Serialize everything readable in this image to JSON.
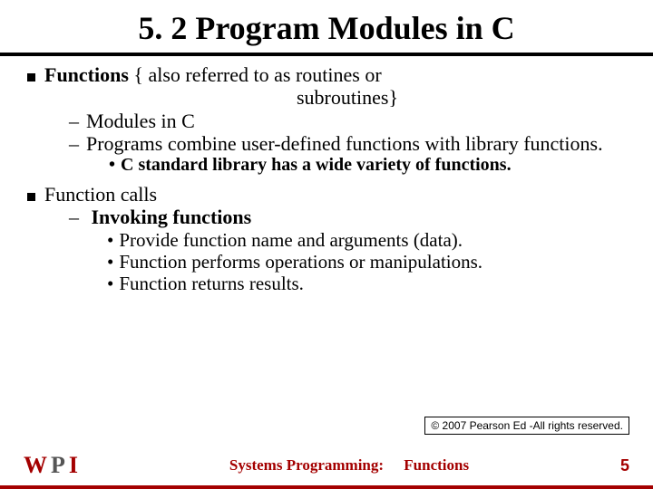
{
  "title": "5. 2 Program Modules in C",
  "section1": {
    "lead_bold": "Functions",
    "lead_rest": "  { also referred to as routines or",
    "lead_line2": "subroutines}",
    "sub1": "Modules in C",
    "sub2": "Programs combine user-defined functions with library functions.",
    "mini": "C standard library has a wide variety of functions."
  },
  "section2": {
    "lead": "Function calls",
    "sub1": "Invoking functions",
    "m1": "Provide function name and arguments (data).",
    "m2": "Function performs operations or manipulations.",
    "m3": "Function returns results."
  },
  "copyright": "© 2007 Pearson Ed -All rights reserved.",
  "footer": {
    "label": "Systems Programming:",
    "topic": "Functions",
    "page": "5"
  }
}
